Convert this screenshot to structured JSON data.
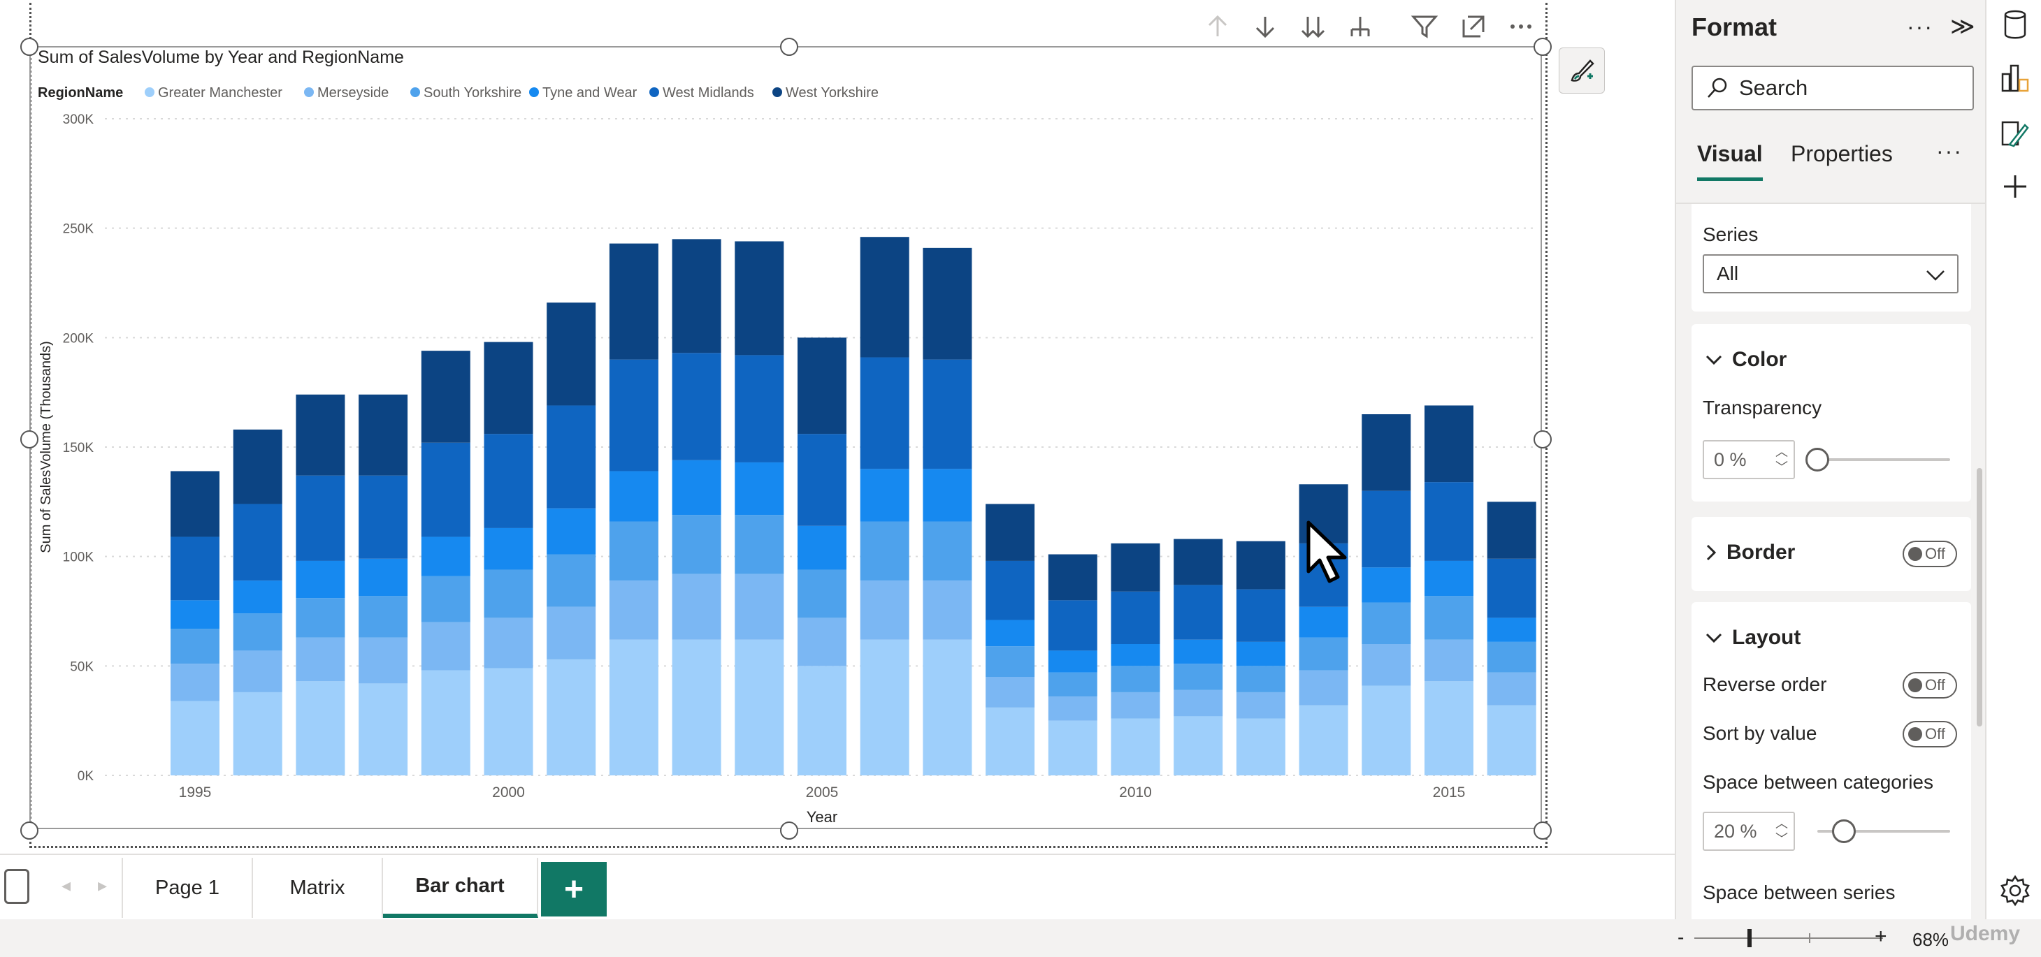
{
  "chart_data": {
    "type": "bar",
    "stacked": true,
    "title": "Sum of SalesVolume by Year and RegionName",
    "xlabel": "Year",
    "ylabel": "Sum of SalesVolume (Thousands)",
    "ylim": [
      0,
      300000
    ],
    "y_ticks": [
      "0K",
      "50K",
      "100K",
      "150K",
      "200K",
      "250K",
      "300K"
    ],
    "y_tick_values": [
      0,
      50000,
      100000,
      150000,
      200000,
      250000,
      300000
    ],
    "x_tick_labels": [
      "1995",
      "2000",
      "2005",
      "2010",
      "2015"
    ],
    "grid": true,
    "legend_title": "RegionName",
    "legend_position": "top-left",
    "categories": [
      1995,
      1996,
      1997,
      1998,
      1999,
      2000,
      2001,
      2002,
      2003,
      2004,
      2005,
      2006,
      2007,
      2008,
      2009,
      2010,
      2011,
      2012,
      2013,
      2014,
      2015,
      2016
    ],
    "series": [
      {
        "name": "Greater Manchester",
        "color": "#9ECFFB",
        "values": [
          34000,
          38000,
          43000,
          42000,
          48000,
          49000,
          53000,
          62000,
          62000,
          62000,
          50000,
          62000,
          62000,
          31000,
          25000,
          26000,
          27000,
          26000,
          32000,
          41000,
          43000,
          32000
        ]
      },
      {
        "name": "Merseyside",
        "color": "#7BB7F3",
        "values": [
          17000,
          19000,
          20000,
          21000,
          22000,
          23000,
          24000,
          27000,
          30000,
          30000,
          22000,
          27000,
          27000,
          14000,
          11000,
          12000,
          12000,
          12000,
          16000,
          19000,
          19000,
          15000
        ]
      },
      {
        "name": "South Yorkshire",
        "color": "#4EA2EC",
        "values": [
          16000,
          17000,
          18000,
          19000,
          21000,
          22000,
          24000,
          27000,
          27000,
          27000,
          22000,
          27000,
          27000,
          14000,
          11000,
          12000,
          12000,
          12000,
          15000,
          19000,
          20000,
          14000
        ]
      },
      {
        "name": "Tyne and Wear",
        "color": "#1689F0",
        "values": [
          13000,
          15000,
          17000,
          17000,
          18000,
          19000,
          21000,
          23000,
          25000,
          24000,
          20000,
          24000,
          24000,
          12000,
          10000,
          10000,
          11000,
          11000,
          14000,
          16000,
          16000,
          11000
        ]
      },
      {
        "name": "West Midlands",
        "color": "#0F65C1",
        "values": [
          29000,
          35000,
          39000,
          38000,
          43000,
          43000,
          47000,
          51000,
          49000,
          49000,
          42000,
          51000,
          50000,
          27000,
          23000,
          24000,
          25000,
          24000,
          29000,
          35000,
          36000,
          27000
        ]
      },
      {
        "name": "West Yorkshire",
        "color": "#0C4483",
        "values": [
          30000,
          34000,
          37000,
          37000,
          42000,
          42000,
          47000,
          53000,
          52000,
          52000,
          44000,
          55000,
          51000,
          26000,
          21000,
          22000,
          21000,
          22000,
          27000,
          35000,
          35000,
          26000
        ]
      }
    ]
  },
  "tabs": {
    "items": [
      {
        "label": "Page 1"
      },
      {
        "label": "Matrix"
      },
      {
        "label": "Bar chart"
      }
    ],
    "add_label": "+"
  },
  "format_pane": {
    "title": "Format",
    "more": "···",
    "collapse": "≫",
    "search_placeholder": "Search",
    "tab_visual": "Visual",
    "tab_properties": "Properties",
    "tab_more": "···",
    "series_card": {
      "label": "Series",
      "dropdown_value": "All"
    },
    "color_card": {
      "title": "Color",
      "transparency_label": "Transparency",
      "transparency_value": "0 %",
      "transparency_level": 0
    },
    "border_card": {
      "title": "Border",
      "toggle": "Off"
    },
    "layout_card": {
      "title": "Layout",
      "reverse_order_label": "Reverse order",
      "reverse_order_toggle": "Off",
      "sort_by_value_label": "Sort by value",
      "sort_by_value_toggle": "Off",
      "space_categories_label": "Space between categories",
      "space_categories_value": "20 %",
      "space_categories_level": 20,
      "space_series_label": "Space between series"
    }
  },
  "zoom": {
    "minus": "-",
    "plus": "+",
    "value": "68%"
  },
  "watermark": "Udemy",
  "icons": {
    "sort_ascending": "arrow-up-icon",
    "sort_descending": "arrow-down-icon",
    "expand_all": "double-arrow-down-icon",
    "drill": "fork-icon",
    "filter": "filter-icon",
    "focus": "focus-mode-icon",
    "more": "more-icon",
    "format_brush": "paint-brush-icon"
  }
}
